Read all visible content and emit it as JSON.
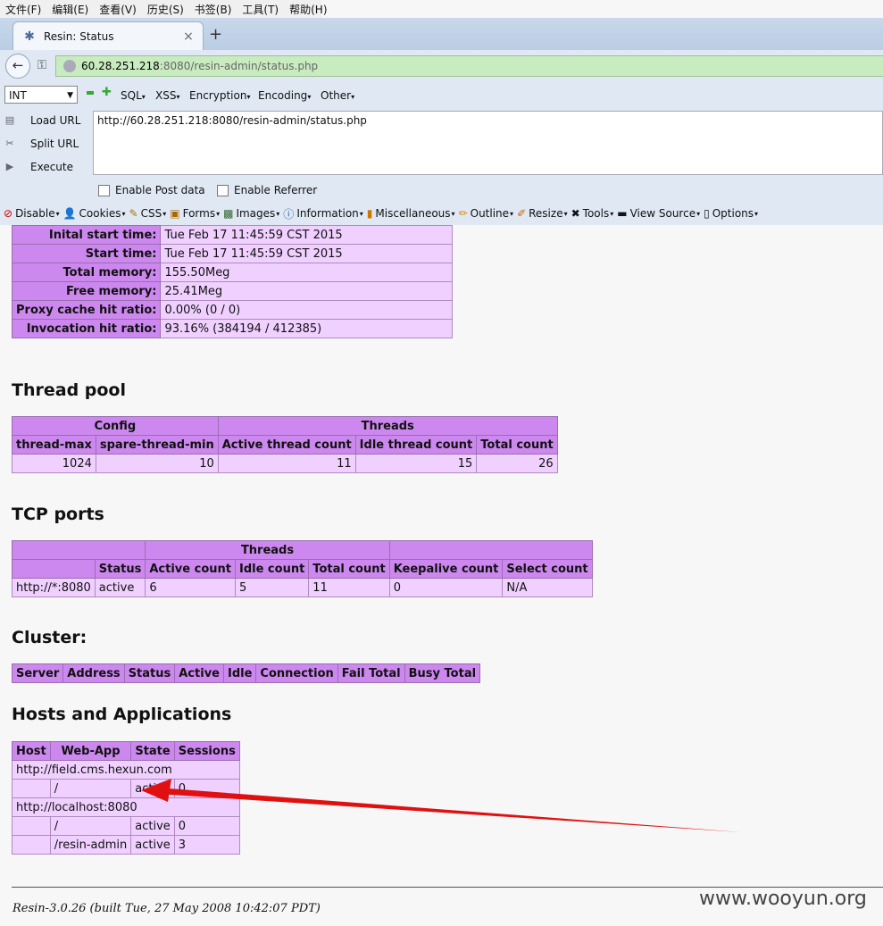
{
  "menubar": [
    "文件(F)",
    "编辑(E)",
    "查看(V)",
    "历史(S)",
    "书签(B)",
    "工具(T)",
    "帮助(H)"
  ],
  "tab": {
    "title": "Resin: Status",
    "close": "×",
    "newtab": "+"
  },
  "address": {
    "host": "60.28.251.218",
    "rest": ":8080/resin-admin/status.php"
  },
  "hackbar": {
    "select_value": "INT",
    "menus": [
      "SQL",
      "XSS",
      "Encryption",
      "Encoding",
      "Other"
    ],
    "side": [
      "Load URL",
      "Split URL",
      "Execute"
    ],
    "url_text": "http://60.28.251.218:8080/resin-admin/status.php",
    "checks": [
      "Enable Post data",
      "Enable Referrer"
    ]
  },
  "webdev": [
    "Disable",
    "Cookies",
    "CSS",
    "Forms",
    "Images",
    "Information",
    "Miscellaneous",
    "Outline",
    "Resize",
    "Tools",
    "View Source",
    "Options"
  ],
  "server_info": [
    {
      "label": "Inital start time:",
      "value": "Tue Feb 17 11:45:59 CST 2015"
    },
    {
      "label": "Start time:",
      "value": "Tue Feb 17 11:45:59 CST 2015"
    },
    {
      "label": "Total memory:",
      "value": "155.50Meg"
    },
    {
      "label": "Free memory:",
      "value": "25.41Meg"
    },
    {
      "label": "Proxy cache hit ratio:",
      "value": "0.00% (0 / 0)"
    },
    {
      "label": "Invocation hit ratio:",
      "value": "93.16% (384194 / 412385)"
    }
  ],
  "thread_pool": {
    "heading": "Thread pool",
    "group_config": "Config",
    "group_threads": "Threads",
    "cols": [
      "thread-max",
      "spare-thread-min",
      "Active thread count",
      "Idle thread count",
      "Total count"
    ],
    "row": [
      "1024",
      "10",
      "11",
      "15",
      "26"
    ]
  },
  "tcp": {
    "heading": "TCP ports",
    "group_threads": "Threads",
    "cols": [
      "Status",
      "Active count",
      "Idle count",
      "Total count",
      "Keepalive count",
      "Select count"
    ],
    "row": [
      "http://*:8080",
      "active",
      "6",
      "5",
      "11",
      "0",
      "N/A"
    ]
  },
  "cluster": {
    "heading": "Cluster:",
    "cols": [
      "Server",
      "Address",
      "Status",
      "Active",
      "Idle",
      "Connection",
      "Fail Total",
      "Busy Total"
    ]
  },
  "hosts": {
    "heading": "Hosts and Applications",
    "cols": [
      "Host",
      "Web-App",
      "State",
      "Sessions"
    ],
    "host1": "http://field.cms.hexun.com",
    "app1": [
      "/",
      "active",
      "0"
    ],
    "host2": "http://localhost:8080",
    "app2": [
      "/",
      "active",
      "0"
    ],
    "app3": [
      "/resin-admin",
      "active",
      "3"
    ]
  },
  "footer": "Resin-3.0.26 (built Tue, 27 May 2008 10:42:07 PDT)",
  "watermark": "www.wooyun.org"
}
